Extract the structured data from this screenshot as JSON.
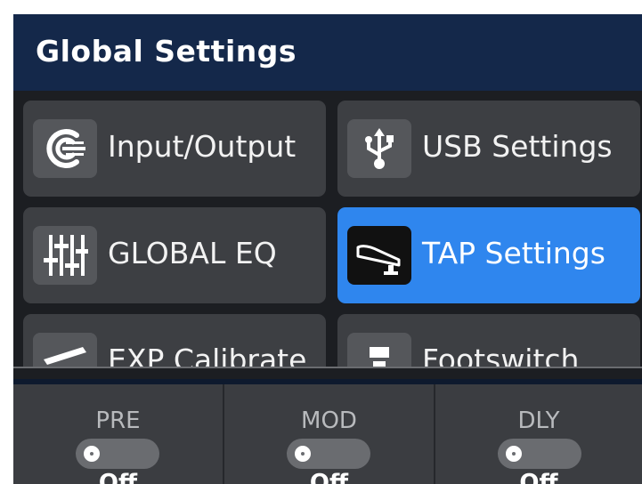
{
  "header": {
    "title": "Global Settings"
  },
  "tiles": [
    {
      "label": "Input/Output",
      "icon": "input-output-icon"
    },
    {
      "label": "USB Settings",
      "icon": "usb-icon"
    },
    {
      "label": "GLOBAL EQ",
      "icon": "eq-sliders-icon"
    },
    {
      "label": "TAP Settings",
      "icon": "tap-pedal-icon",
      "active": true
    },
    {
      "label": "EXP Calibrate",
      "icon": "expression-pedal-icon"
    },
    {
      "label": "Footswitch",
      "icon": "footswitch-icon"
    }
  ],
  "effects": [
    {
      "name": "PRE",
      "state": "Off",
      "on": false
    },
    {
      "name": "MOD",
      "state": "Off",
      "on": false
    },
    {
      "name": "DLY",
      "state": "Off",
      "on": false
    }
  ],
  "colors": {
    "header_bg": "#14284a",
    "tile_bg": "#3d3f43",
    "active_tile": "#2f86ee",
    "bottom_bar": "#3b3d41"
  }
}
